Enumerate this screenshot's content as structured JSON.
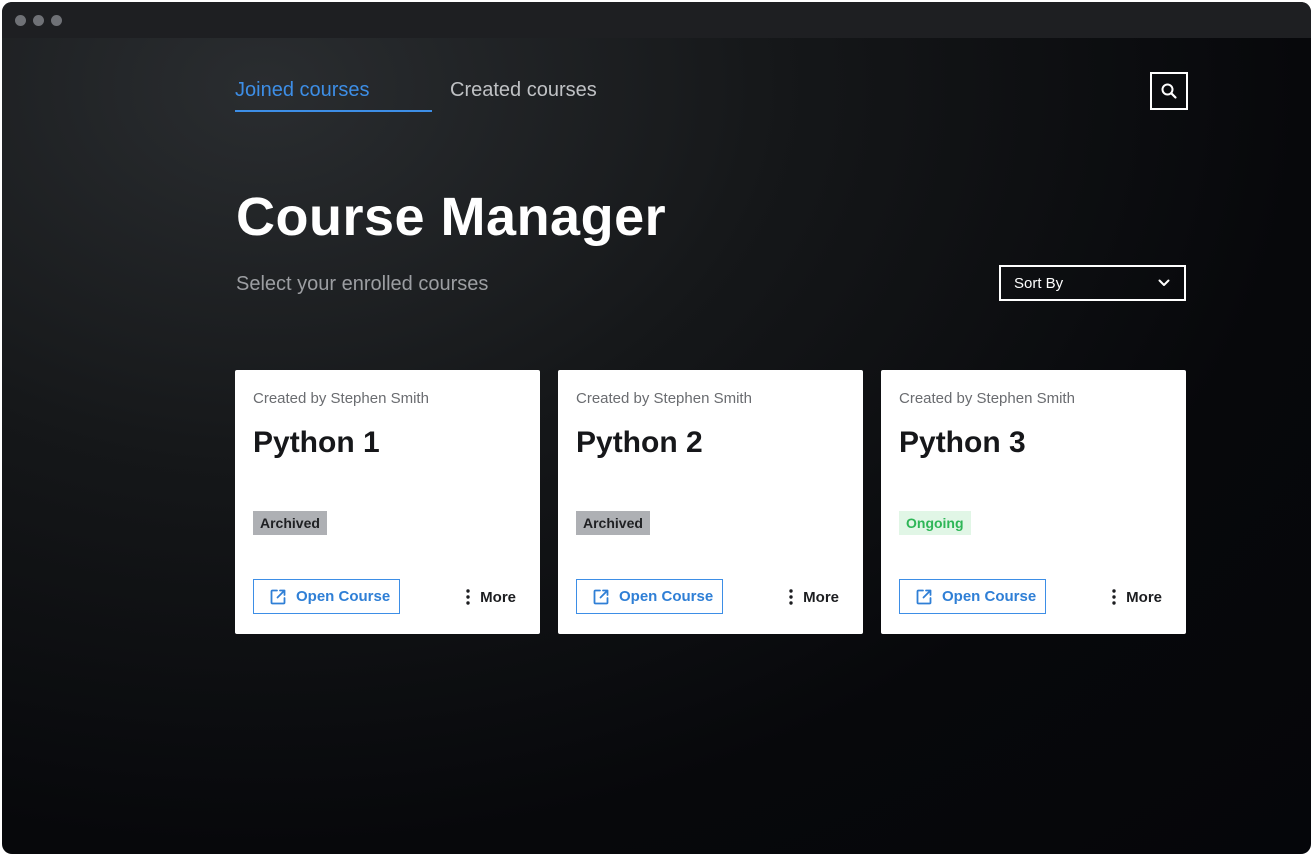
{
  "tabs": [
    {
      "label": "Joined courses",
      "active": true
    },
    {
      "label": "Created courses",
      "active": false
    }
  ],
  "header": {
    "title": "Course Manager",
    "subtitle": "Select your enrolled courses"
  },
  "sort": {
    "label": "Sort By"
  },
  "courses": [
    {
      "creator": "Created by Stephen Smith",
      "title": "Python 1",
      "status": "Archived",
      "open_label": "Open Course",
      "more_label": "More"
    },
    {
      "creator": "Created by Stephen Smith",
      "title": "Python 2",
      "status": "Archived",
      "open_label": "Open Course",
      "more_label": "More"
    },
    {
      "creator": "Created by Stephen Smith",
      "title": "Python 3",
      "status": "Ongoing",
      "open_label": "Open Course",
      "more_label": "More"
    }
  ],
  "colors": {
    "accent": "#3d8ee6",
    "archived_badge": "#aeb0b4",
    "ongoing_badge_bg": "#e1f6e6",
    "ongoing_badge_text": "#2eb657"
  },
  "icons": {
    "search": "search-icon",
    "dropdown": "chevron-down-icon",
    "open": "external-link-icon",
    "more": "more-vertical-icon"
  }
}
